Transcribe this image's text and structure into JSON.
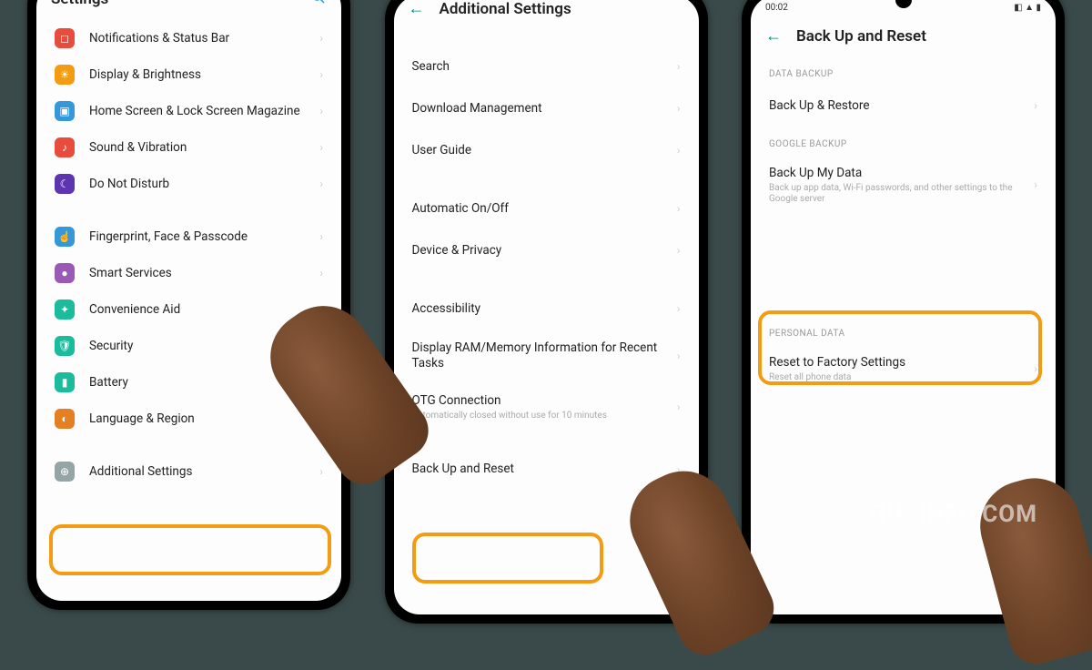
{
  "watermark": "GUSINFO.COM",
  "phone1": {
    "title": "Settings",
    "items": [
      {
        "icon_bg": "#E74C3C",
        "icon_glyph": "◻",
        "label": "Notifications & Status Bar"
      },
      {
        "icon_bg": "#F39C12",
        "icon_glyph": "☀",
        "label": "Display & Brightness"
      },
      {
        "icon_bg": "#3498DB",
        "icon_glyph": "▣",
        "label": "Home Screen & Lock Screen Magazine"
      },
      {
        "icon_bg": "#E74C3C",
        "icon_glyph": "♪",
        "label": "Sound & Vibration"
      },
      {
        "icon_bg": "#5E35B1",
        "icon_glyph": "☾",
        "label": "Do Not Disturb"
      }
    ],
    "items2": [
      {
        "icon_bg": "#3498DB",
        "icon_glyph": "☝",
        "label": "Fingerprint, Face & Passcode"
      },
      {
        "icon_bg": "#9B59B6",
        "icon_glyph": "●",
        "label": "Smart Services"
      },
      {
        "icon_bg": "#1ABC9C",
        "icon_glyph": "✦",
        "label": "Convenience Aid"
      },
      {
        "icon_bg": "#1ABC9C",
        "icon_glyph": "🛡",
        "label": "Security"
      },
      {
        "icon_bg": "#1ABC9C",
        "icon_glyph": "▮",
        "label": "Battery"
      },
      {
        "icon_bg": "#E67E22",
        "icon_glyph": "◐",
        "label": "Language & Region"
      }
    ],
    "items3": [
      {
        "icon_bg": "#95A5A6",
        "icon_glyph": "⊕",
        "label": "Additional Settings"
      }
    ]
  },
  "phone2": {
    "title": "Additional Settings",
    "groupA": [
      {
        "label": "Search"
      },
      {
        "label": "Download Management"
      },
      {
        "label": "User Guide"
      }
    ],
    "groupB": [
      {
        "label": "Automatic On/Off"
      },
      {
        "label": "Device & Privacy"
      }
    ],
    "groupC": [
      {
        "label": "Accessibility"
      },
      {
        "label": "Display RAM/Memory Information for Recent Tasks"
      },
      {
        "label": "OTG Connection",
        "sub": "Automatically closed without use for 10 minutes"
      }
    ],
    "groupD": [
      {
        "label": "Back Up and Reset"
      }
    ]
  },
  "phone3": {
    "status_time": "00:02",
    "title": "Back Up and Reset",
    "sec1": "DATA BACKUP",
    "row1": {
      "label": "Back Up & Restore"
    },
    "sec2": "GOOGLE BACKUP",
    "row2": {
      "label": "Back Up My Data",
      "sub": "Back up app data, Wi-Fi passwords, and other settings to the Google server"
    },
    "sec3": "PERSONAL DATA",
    "row3": {
      "label": "Reset to Factory Settings",
      "sub": "Reset all phone data"
    }
  }
}
